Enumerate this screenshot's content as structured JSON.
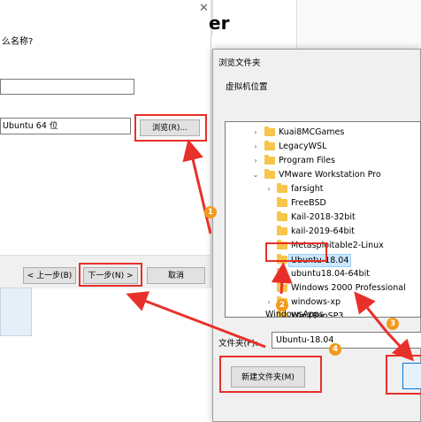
{
  "wizard": {
    "question_label": "么名称?",
    "location_value": "Ubuntu 64 位",
    "browse_button": "浏览(R)...",
    "back_button": "< 上一步(B)",
    "next_button": "下一步(N) >",
    "cancel_button": "取消",
    "header_fragment": "er"
  },
  "dialog": {
    "title": "浏览文件夹",
    "subtitle": "虚拟机位置",
    "tree": [
      {
        "label": "Kuai8MCGames"
      },
      {
        "label": "LegacyWSL"
      },
      {
        "label": "Program Files"
      },
      {
        "label": "VMware Workstation Pro"
      },
      {
        "label": "farsight"
      },
      {
        "label": "FreeBSD"
      },
      {
        "label": "Kail-2018-32bit"
      },
      {
        "label": "kail-2019-64bit"
      },
      {
        "label": "Metasploitable2-Linux"
      },
      {
        "label": "Ubuntu-18.04",
        "selected": true
      },
      {
        "label": "ubuntu18.04-64bit"
      },
      {
        "label": "Windows 2000 Professional"
      },
      {
        "label": "windows-xp"
      },
      {
        "label": "WinXPenSP3"
      },
      {
        "label": "WindowsApps"
      }
    ],
    "folder_label": "文件夹(F):",
    "folder_value": "Ubuntu-18.04",
    "new_folder_button": "新建文件夹(M)"
  },
  "annotations": {
    "badges": [
      "1",
      "2",
      "3",
      "4"
    ],
    "arrow_color": "#e8302a",
    "badge_color": "#f39a1c"
  }
}
